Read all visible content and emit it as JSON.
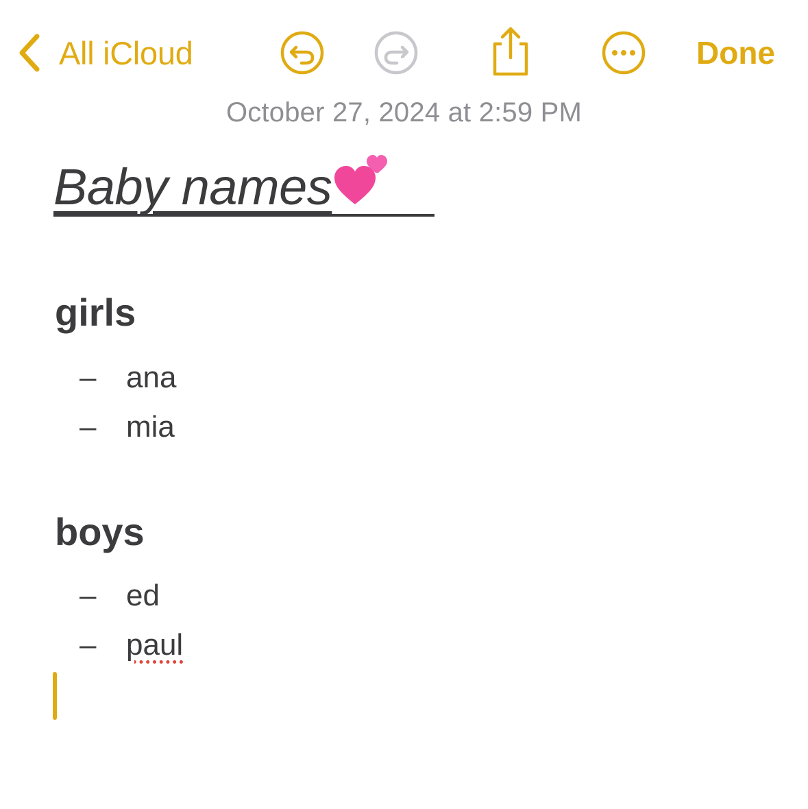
{
  "toolbar": {
    "back_label": "All iCloud",
    "done_label": "Done",
    "icons": [
      "chevron-left-icon",
      "undo-icon",
      "redo-icon",
      "share-icon",
      "more-icon"
    ]
  },
  "timestamp": "October 27, 2024 at 2:59 PM",
  "note": {
    "title": "Baby names",
    "title_emoji": "💕",
    "sections": [
      {
        "heading": "girls",
        "items": [
          "ana",
          "mia"
        ]
      },
      {
        "heading": "boys",
        "items": [
          "ed",
          "paul"
        ]
      }
    ],
    "list_marker": "–"
  },
  "colors": {
    "accent": "#e0ab12",
    "disabled": "#c7c7cc",
    "text": "#3c3c3e",
    "secondary_text": "#8e8e93",
    "spellcheck": "#e0443a",
    "emoji_pink": "#f0479b"
  }
}
